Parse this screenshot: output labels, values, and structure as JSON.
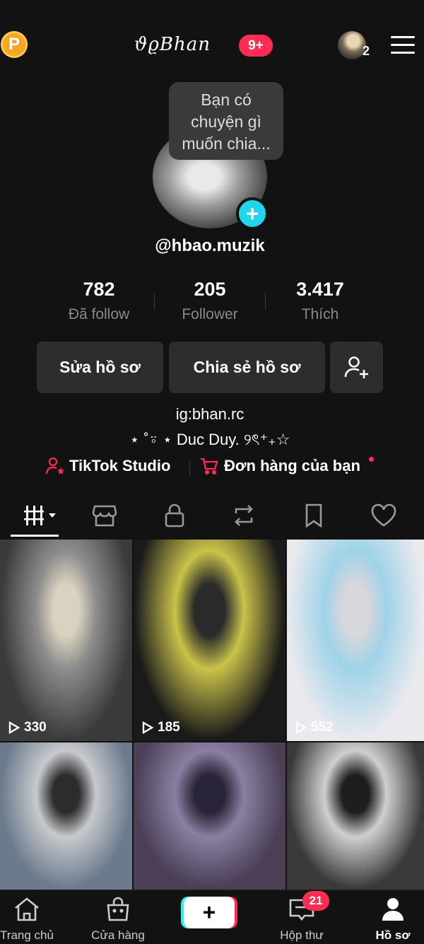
{
  "header": {
    "coin_label": "P",
    "brand_name": "ϑϱBhan",
    "brand_badge": "9+",
    "account_count": "2"
  },
  "profile": {
    "bubble_text": "Bạn có chuyện gì muốn chia...",
    "avatar_add_label": "+",
    "username": "@hbao.muzik",
    "stats": [
      {
        "value": "782",
        "label": "Đã follow"
      },
      {
        "value": "205",
        "label": "Follower"
      },
      {
        "value": "3.417",
        "label": "Thích"
      }
    ],
    "edit_button": "Sửa hồ sơ",
    "share_button": "Chia sẻ hồ sơ",
    "bio_line1": "ig:bhan.rc",
    "bio_line2": "⋆ ˚⍤ ⋆ Duc Duy. ୨ৎ⁺₊☆",
    "studio_link": "TikTok Studio",
    "orders_link": "Đơn hàng của bạn"
  },
  "tabs": [
    "grid-icon",
    "shop-icon",
    "lock-icon",
    "repost-icon",
    "bookmark-icon",
    "heart-icon"
  ],
  "videos": [
    {
      "views": "330",
      "colors": [
        "#3b3b3b",
        "#8d8d8d",
        "#d9d2c0"
      ]
    },
    {
      "views": "185",
      "colors": [
        "#1a1a1a",
        "#c9c24a",
        "#2a2a2a"
      ]
    },
    {
      "views": "552",
      "colors": [
        "#e9e9ee",
        "#9fd3e8",
        "#d7d7dc"
      ]
    },
    {
      "views": "",
      "colors": [
        "#6b7a8c",
        "#c7c9cc",
        "#2c2c2c"
      ]
    },
    {
      "views": "",
      "colors": [
        "#4a3f55",
        "#8a7fa2",
        "#2a2438"
      ]
    },
    {
      "views": "",
      "colors": [
        "#3a3a3a",
        "#cfcfcf",
        "#1e1e1e"
      ]
    }
  ],
  "bottom_nav": [
    {
      "label": "Trang chủ",
      "icon": "home-icon"
    },
    {
      "label": "Cửa hàng",
      "icon": "shop-bag-icon"
    },
    {
      "label": "",
      "icon": "create-plus-icon"
    },
    {
      "label": "Hộp thư",
      "icon": "inbox-icon",
      "badge": "21"
    },
    {
      "label": "Hồ sơ",
      "icon": "profile-icon"
    }
  ],
  "colors": {
    "accent_red": "#fe2c55",
    "accent_cyan": "#20d5ec",
    "background": "#121212"
  }
}
